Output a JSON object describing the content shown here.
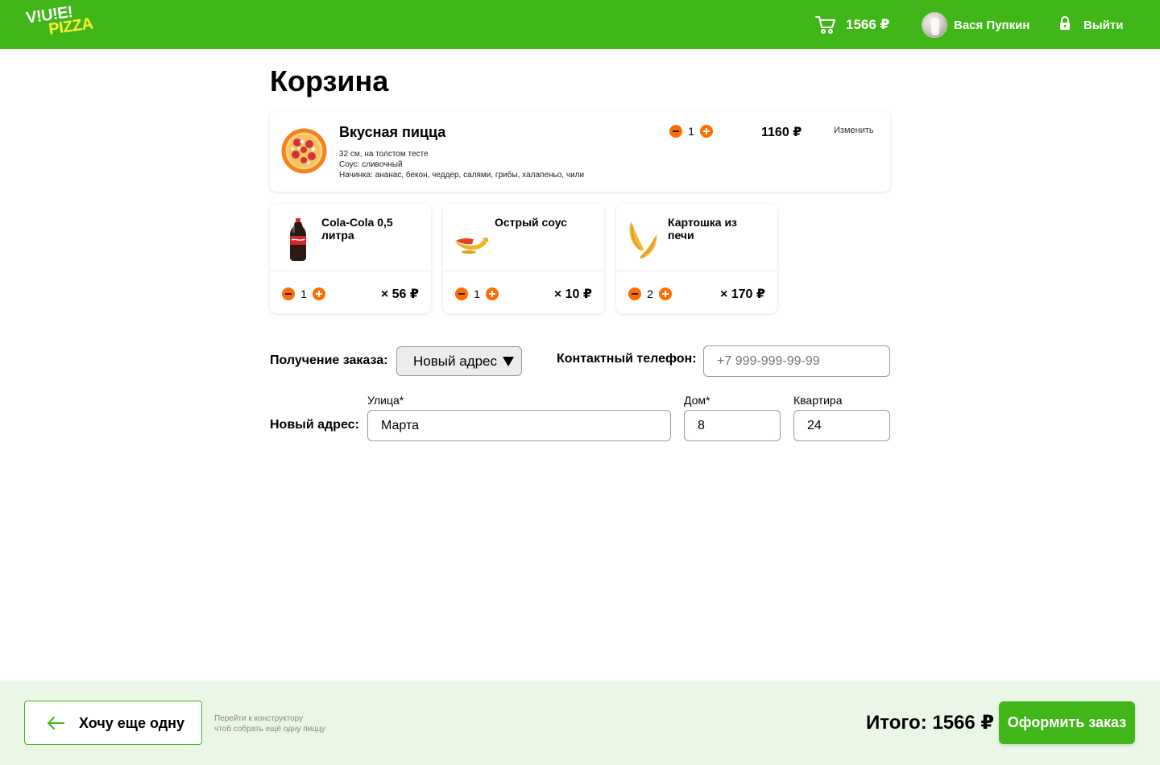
{
  "header": {
    "logo_line1": "V!U!E!",
    "logo_line2": "PIZZA",
    "cart_total": "1566 ₽",
    "user_name": "Вася Пупкин",
    "logout_label": "Выйти"
  },
  "page_title": "Корзина",
  "pizza": {
    "name": "Вкусная пицца",
    "desc_line1": "32 см, на толстом тесте",
    "desc_line2": "Соус: сливочный",
    "desc_line3": "Начинка: ананас, бекон, чеддер, салями, грибы, халапеньо, чили",
    "quantity": "1",
    "price": "1160 ₽",
    "edit_label": "Изменить"
  },
  "extras": [
    {
      "name": "Cola-Cola 0,5 литра",
      "quantity": "1",
      "price": "× 56 ₽",
      "icon": "cola-bottle-icon"
    },
    {
      "name": "Острый соус",
      "quantity": "1",
      "price": "× 10 ₽",
      "icon": "sauce-boat-icon"
    },
    {
      "name": "Картошка из печи",
      "quantity": "2",
      "price": "× 170 ₽",
      "icon": "potato-wedges-icon"
    }
  ],
  "form": {
    "delivery_label": "Получение заказа:",
    "delivery_selected": "Новый адрес",
    "phone_label": "Контактный телефон:",
    "phone_placeholder": "+7 999-999-99-99",
    "new_address_label": "Новый адрес:",
    "street_label": "Улица*",
    "street_value": "Марта",
    "house_label": "Дом*",
    "house_value": "8",
    "apt_label": "Квартира",
    "apt_value": "24"
  },
  "footer": {
    "back_label": "Хочу еще одну",
    "hint_line1": "Перейти к конструктору",
    "hint_line2": "чтоб собрать ещё одну пиццу",
    "total": "Итого: 1566 ₽",
    "order_label": "Оформить заказ"
  },
  "colors": {
    "brand_green": "#41b619",
    "accent_orange": "#ff6d00",
    "footer_bg": "#ebf7e6"
  }
}
